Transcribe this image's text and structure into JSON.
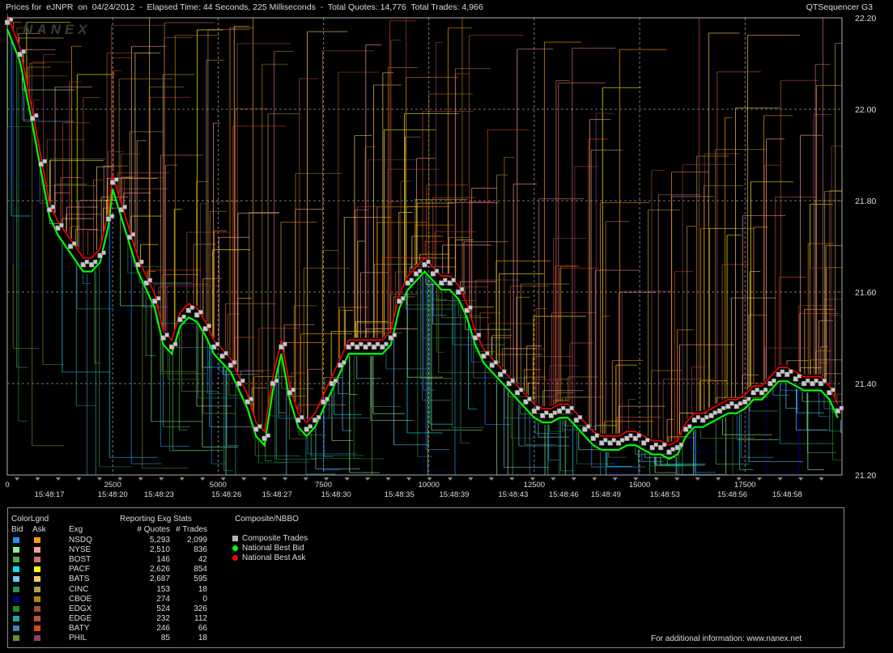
{
  "header": {
    "left": "Prices for  eJNPR  on  04/24/2012  -  Elapsed Time: 44 Seconds, 225 Milliseconds  -  Total Quotes: 14,776  Total Trades: 4,966",
    "right": "QTSequencer G3"
  },
  "watermark": "NANEX",
  "chart_data": {
    "type": "line",
    "title": "Prices for eJNPR on 04/24/2012",
    "xlabel": "",
    "ylabel": "",
    "xlim": [
      0,
      19800
    ],
    "ylim": [
      21.2,
      22.2
    ],
    "y_ticks": [
      "22.20",
      "22.00",
      "21.80",
      "21.60",
      "21.40",
      "21.20"
    ],
    "x_ticks": [
      "0",
      "2500",
      "5000",
      "7500",
      "10000",
      "12500",
      "15000",
      "17500"
    ],
    "time_ticks": [
      "15:48:17",
      "15:48:20",
      "15:48:23",
      "15:48:26",
      "15:48:27",
      "15:48:30",
      "15:48:35",
      "15:48:39",
      "15:48:43",
      "15:48:46",
      "15:48:49",
      "15:48:53",
      "15:48:56",
      "15:48:58"
    ],
    "time_tick_x": [
      1000,
      2500,
      3600,
      5200,
      6400,
      7800,
      9300,
      10600,
      12000,
      13200,
      14200,
      15600,
      17200,
      18500
    ],
    "grid": true,
    "series": [
      {
        "name": "Composite Trades",
        "x": [
          0,
          300,
          600,
          800,
          1000,
          1200,
          1500,
          1800,
          2000,
          2200,
          2400,
          2500,
          2700,
          2900,
          3100,
          3300,
          3500,
          3700,
          3900,
          4100,
          4300,
          4500,
          4700,
          4900,
          5100,
          5300,
          5500,
          5700,
          5900,
          6100,
          6300,
          6500,
          6700,
          6900,
          7100,
          7300,
          7500,
          7700,
          7900,
          8100,
          8300,
          8500,
          8700,
          8900,
          9100,
          9300,
          9500,
          9700,
          9900,
          10100,
          10300,
          10500,
          10700,
          10900,
          11100,
          11300,
          11500,
          11700,
          11900,
          12100,
          12300,
          12500,
          12700,
          12900,
          13100,
          13300,
          13500,
          13700,
          13900,
          14100,
          14300,
          14500,
          14700,
          14900,
          15100,
          15300,
          15500,
          15700,
          15900,
          16100,
          16300,
          16500,
          16700,
          16900,
          17100,
          17300,
          17500,
          17700,
          17900,
          18100,
          18300,
          18500,
          18700,
          18900,
          19100,
          19300,
          19500,
          19700
        ],
        "y": [
          22.19,
          22.12,
          21.98,
          21.88,
          21.78,
          21.74,
          21.7,
          21.66,
          21.66,
          21.68,
          21.76,
          21.84,
          21.78,
          21.72,
          21.66,
          21.62,
          21.58,
          21.5,
          21.48,
          21.54,
          21.56,
          21.55,
          21.52,
          21.48,
          21.46,
          21.44,
          21.4,
          21.36,
          21.3,
          21.28,
          21.4,
          21.48,
          21.38,
          21.32,
          21.3,
          21.32,
          21.36,
          21.4,
          21.44,
          21.48,
          21.48,
          21.48,
          21.48,
          21.48,
          21.5,
          21.58,
          21.62,
          21.64,
          21.66,
          21.64,
          21.62,
          21.62,
          21.6,
          21.56,
          21.5,
          21.46,
          21.44,
          21.42,
          21.4,
          21.38,
          21.36,
          21.34,
          21.33,
          21.33,
          21.34,
          21.34,
          21.32,
          21.3,
          21.28,
          21.27,
          21.27,
          21.27,
          21.28,
          21.28,
          21.27,
          21.26,
          21.26,
          21.25,
          21.26,
          21.3,
          21.32,
          21.32,
          21.33,
          21.34,
          21.35,
          21.35,
          21.36,
          21.38,
          21.38,
          21.4,
          21.42,
          21.42,
          21.41,
          21.4,
          21.4,
          21.4,
          21.38,
          21.34
        ]
      },
      {
        "name": "National Best Bid",
        "offset": -0.015
      },
      {
        "name": "National Best Ask",
        "offset": 0.015
      }
    ]
  },
  "legend": {
    "color_legend_title": "ColorLgnd",
    "bid_header": "Bid",
    "ask_header": "Ask",
    "exg_header": "Exg",
    "stats_title": "Reporting Exg Stats",
    "quotes_header": "# Quotes",
    "trades_header": "# Trades",
    "composite_title": "Composite/NBBO",
    "composite_items": [
      {
        "label": "Composite Trades",
        "color": "#b4b4b4",
        "shape": "square"
      },
      {
        "label": "National Best Bid",
        "color": "#00ff00",
        "shape": "circle"
      },
      {
        "label": "National Best Ask",
        "color": "#ff0000",
        "shape": "circle"
      }
    ],
    "exchanges": [
      {
        "name": "NSDQ",
        "quotes": "5,293",
        "trades": "2,099",
        "bid": "#1e90ff",
        "ask": "#ff9900"
      },
      {
        "name": "NYSE",
        "quotes": "2,510",
        "trades": "836",
        "bid": "#90ee90",
        "ask": "#ff9b9b"
      },
      {
        "name": "BOST",
        "quotes": "146",
        "trades": "42",
        "bid": "#4caf50",
        "ask": "#d2736b"
      },
      {
        "name": "PACF",
        "quotes": "2,626",
        "trades": "854",
        "bid": "#00e5ee",
        "ask": "#ffff00"
      },
      {
        "name": "BATS",
        "quotes": "2,687",
        "trades": "595",
        "bid": "#6ec6ff",
        "ask": "#ffc864"
      },
      {
        "name": "CINC",
        "quotes": "153",
        "trades": "18",
        "bid": "#2e8b57",
        "ask": "#b4a050"
      },
      {
        "name": "CBOE",
        "quotes": "274",
        "trades": "0",
        "bid": "#00008b",
        "ask": "#b8860b"
      },
      {
        "name": "EDGX",
        "quotes": "524",
        "trades": "326",
        "bid": "#228b22",
        "ask": "#a0522d"
      },
      {
        "name": "EDGE",
        "quotes": "232",
        "trades": "112",
        "bid": "#2aa198",
        "ask": "#c0503c"
      },
      {
        "name": "BATY",
        "quotes": "246",
        "trades": "66",
        "bid": "#4682b4",
        "ask": "#e0441a"
      },
      {
        "name": "PHIL",
        "quotes": "85",
        "trades": "18",
        "bid": "#6b8e23",
        "ask": "#9b3c64"
      }
    ],
    "footer": "For additional information: www.nanex.net"
  },
  "colors": {
    "background": "#000000",
    "grid": "#a0a0a0",
    "trade": "#c8c8c8",
    "bid": "#00ff00",
    "ask": "#ff0000"
  }
}
